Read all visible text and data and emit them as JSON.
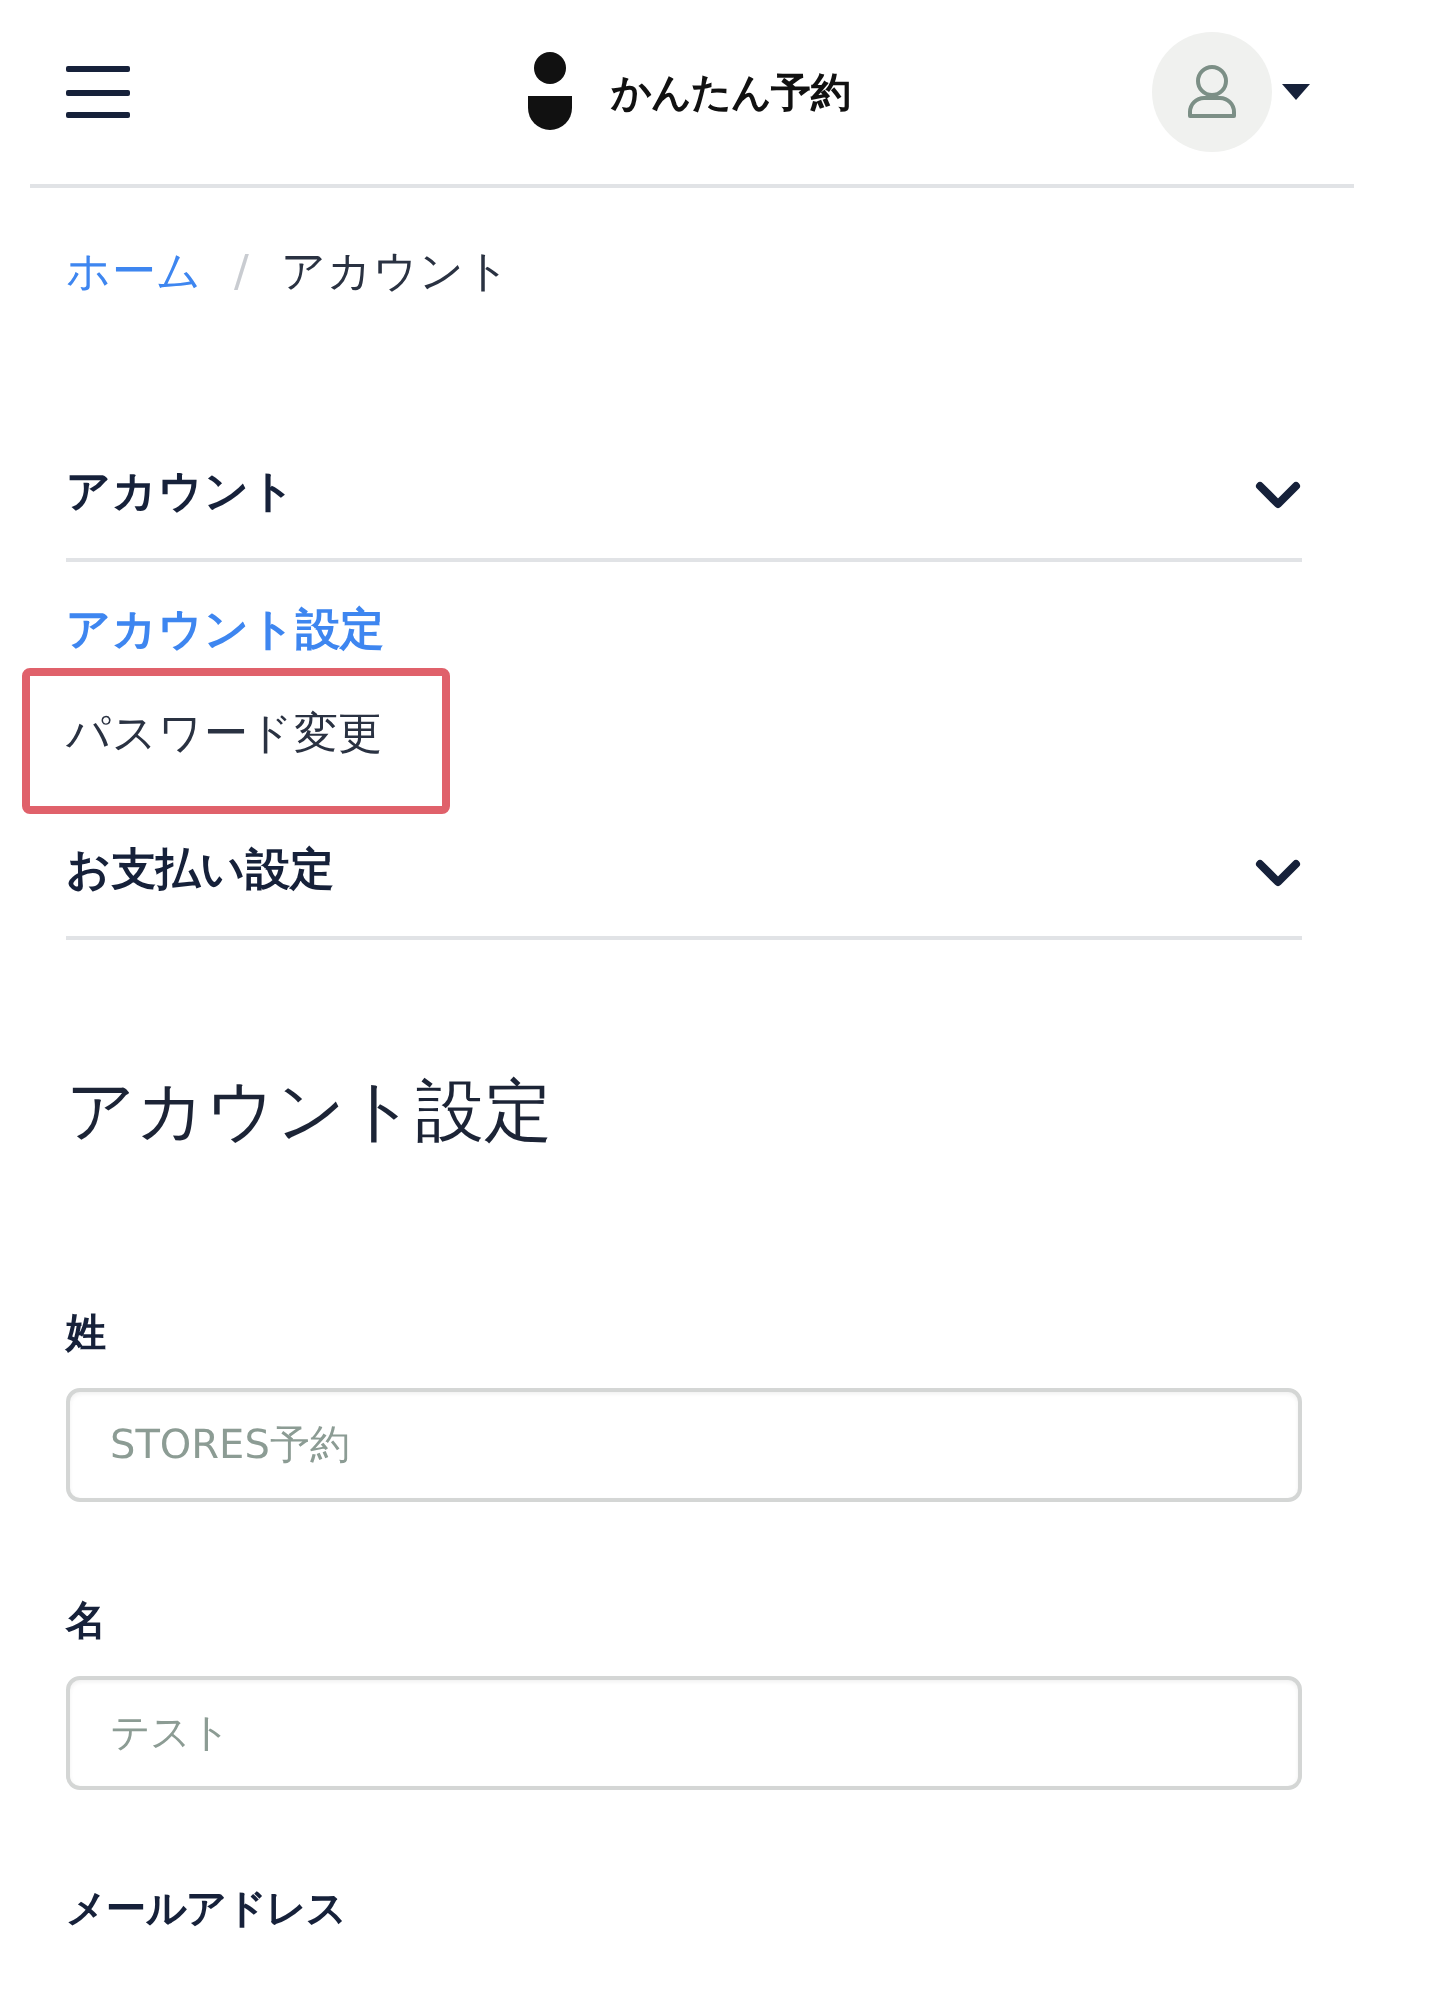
{
  "header": {
    "title": "かんたん予約"
  },
  "breadcrumb": {
    "separator": "/",
    "items": [
      {
        "label": "ホーム",
        "kind": "link"
      },
      {
        "label": "アカウント",
        "kind": "current"
      }
    ]
  },
  "menu": [
    {
      "title": "アカウント",
      "items": [
        {
          "label": "アカウント設定",
          "selected": true,
          "annotated": false
        },
        {
          "label": "パスワード変更",
          "selected": false,
          "annotated": true
        }
      ]
    },
    {
      "title": "お支払い設定"
    }
  ],
  "page_title": "アカウント設定",
  "fields": [
    {
      "label": "姓",
      "value": "STORES予約"
    },
    {
      "label": "名",
      "value": "テスト"
    },
    {
      "label": "メールアドレス"
    }
  ]
}
